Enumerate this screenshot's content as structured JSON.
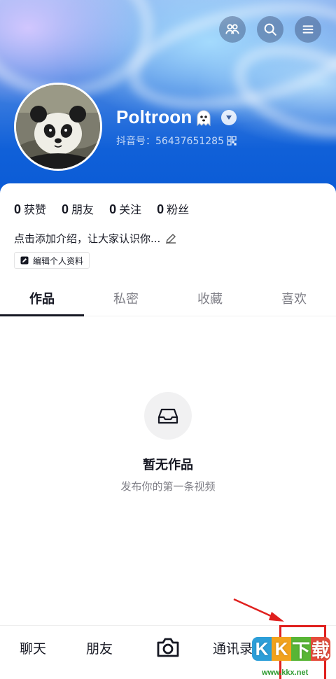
{
  "profile": {
    "name": "Poltroon",
    "douyin_id": "抖音号：56437651285"
  },
  "header_actions": [
    "friends-icon",
    "search-icon",
    "menu-icon"
  ],
  "stats": [
    {
      "value": "0",
      "label": "获赞"
    },
    {
      "value": "0",
      "label": "朋友"
    },
    {
      "value": "0",
      "label": "关注"
    },
    {
      "value": "0",
      "label": "粉丝"
    }
  ],
  "bio": "点击添加介绍，让大家认识你...",
  "edit_profile_label": "编辑个人资料",
  "tabs": [
    {
      "label": "作品",
      "active": true
    },
    {
      "label": "私密",
      "active": false
    },
    {
      "label": "收藏",
      "active": false
    },
    {
      "label": "喜欢",
      "active": false
    }
  ],
  "empty_state": {
    "title": "暂无作品",
    "subtitle": "发布你的第一条视频"
  },
  "bottom_nav": {
    "chat": "聊天",
    "friends": "朋友",
    "contacts": "通讯录"
  },
  "watermark": {
    "chars": [
      "K",
      "K",
      "下",
      "载"
    ],
    "url": "www.kkx.net"
  },
  "colors": {
    "header_blue": "#0a5bd6",
    "text_primary": "#161823",
    "text_secondary": "#7f7f87",
    "annotation_red": "#e0201e"
  }
}
